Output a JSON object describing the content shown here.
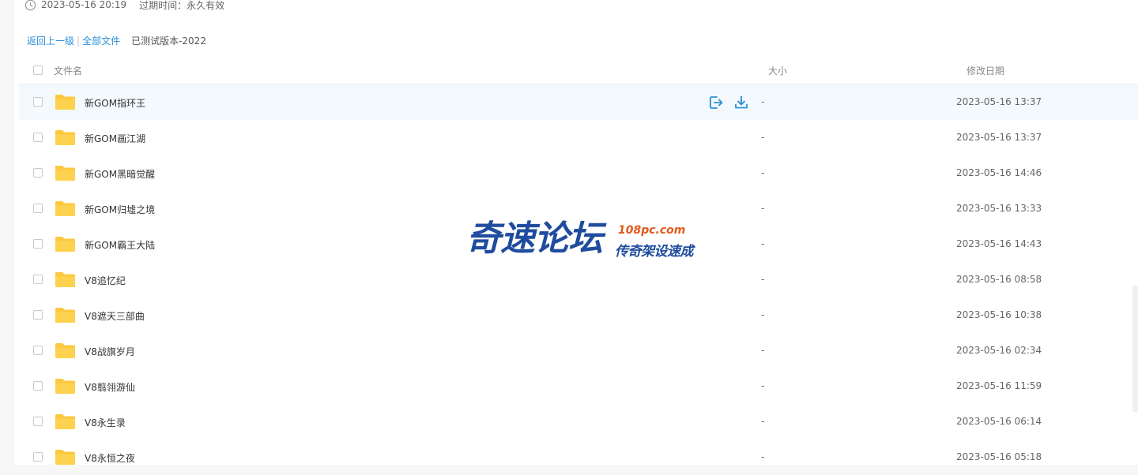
{
  "meta": {
    "created": "2023-05-16 20:19",
    "expiry": "过期时间：永久有效"
  },
  "breadcrumb": {
    "back": "返回上一级",
    "sep": "|",
    "all": "全部文件",
    "current": "已测试版本-2022"
  },
  "columns": {
    "name": "文件名",
    "size": "大小",
    "date": "修改日期"
  },
  "files": [
    {
      "name": "新GOM指环王",
      "size": "-",
      "date": "2023-05-16 13:37"
    },
    {
      "name": "新GOM画江湖",
      "size": "-",
      "date": "2023-05-16 13:37"
    },
    {
      "name": "新GOM黑暗觉醒",
      "size": "-",
      "date": "2023-05-16 14:46"
    },
    {
      "name": "新GOM归墟之境",
      "size": "-",
      "date": "2023-05-16 13:33"
    },
    {
      "name": "新GOM霸王大陆",
      "size": "-",
      "date": "2023-05-16 14:43"
    },
    {
      "name": "V8追忆纪",
      "size": "-",
      "date": "2023-05-16 08:58"
    },
    {
      "name": "V8遮天三部曲",
      "size": "-",
      "date": "2023-05-16 10:38"
    },
    {
      "name": "V8战旗岁月",
      "size": "-",
      "date": "2023-05-16 02:34"
    },
    {
      "name": "V8翦翎游仙",
      "size": "-",
      "date": "2023-05-16 11:59"
    },
    {
      "name": "V8永生录",
      "size": "-",
      "date": "2023-05-16 06:14"
    },
    {
      "name": "V8永恒之夜",
      "size": "-",
      "date": "2023-05-16 05:18"
    }
  ],
  "row_actions": {
    "icons": [
      "share-icon",
      "download-icon"
    ]
  },
  "watermark": {
    "main": "奇速论坛",
    "domain": "108pc.com",
    "slogan": "传奇架设速成"
  },
  "colors": {
    "accent": "#2a8fd8",
    "folder": "#fcc83e",
    "row_hover": "#f3f9fd",
    "watermark_blue": "#1f4c9e",
    "watermark_orange": "#e2591b"
  }
}
